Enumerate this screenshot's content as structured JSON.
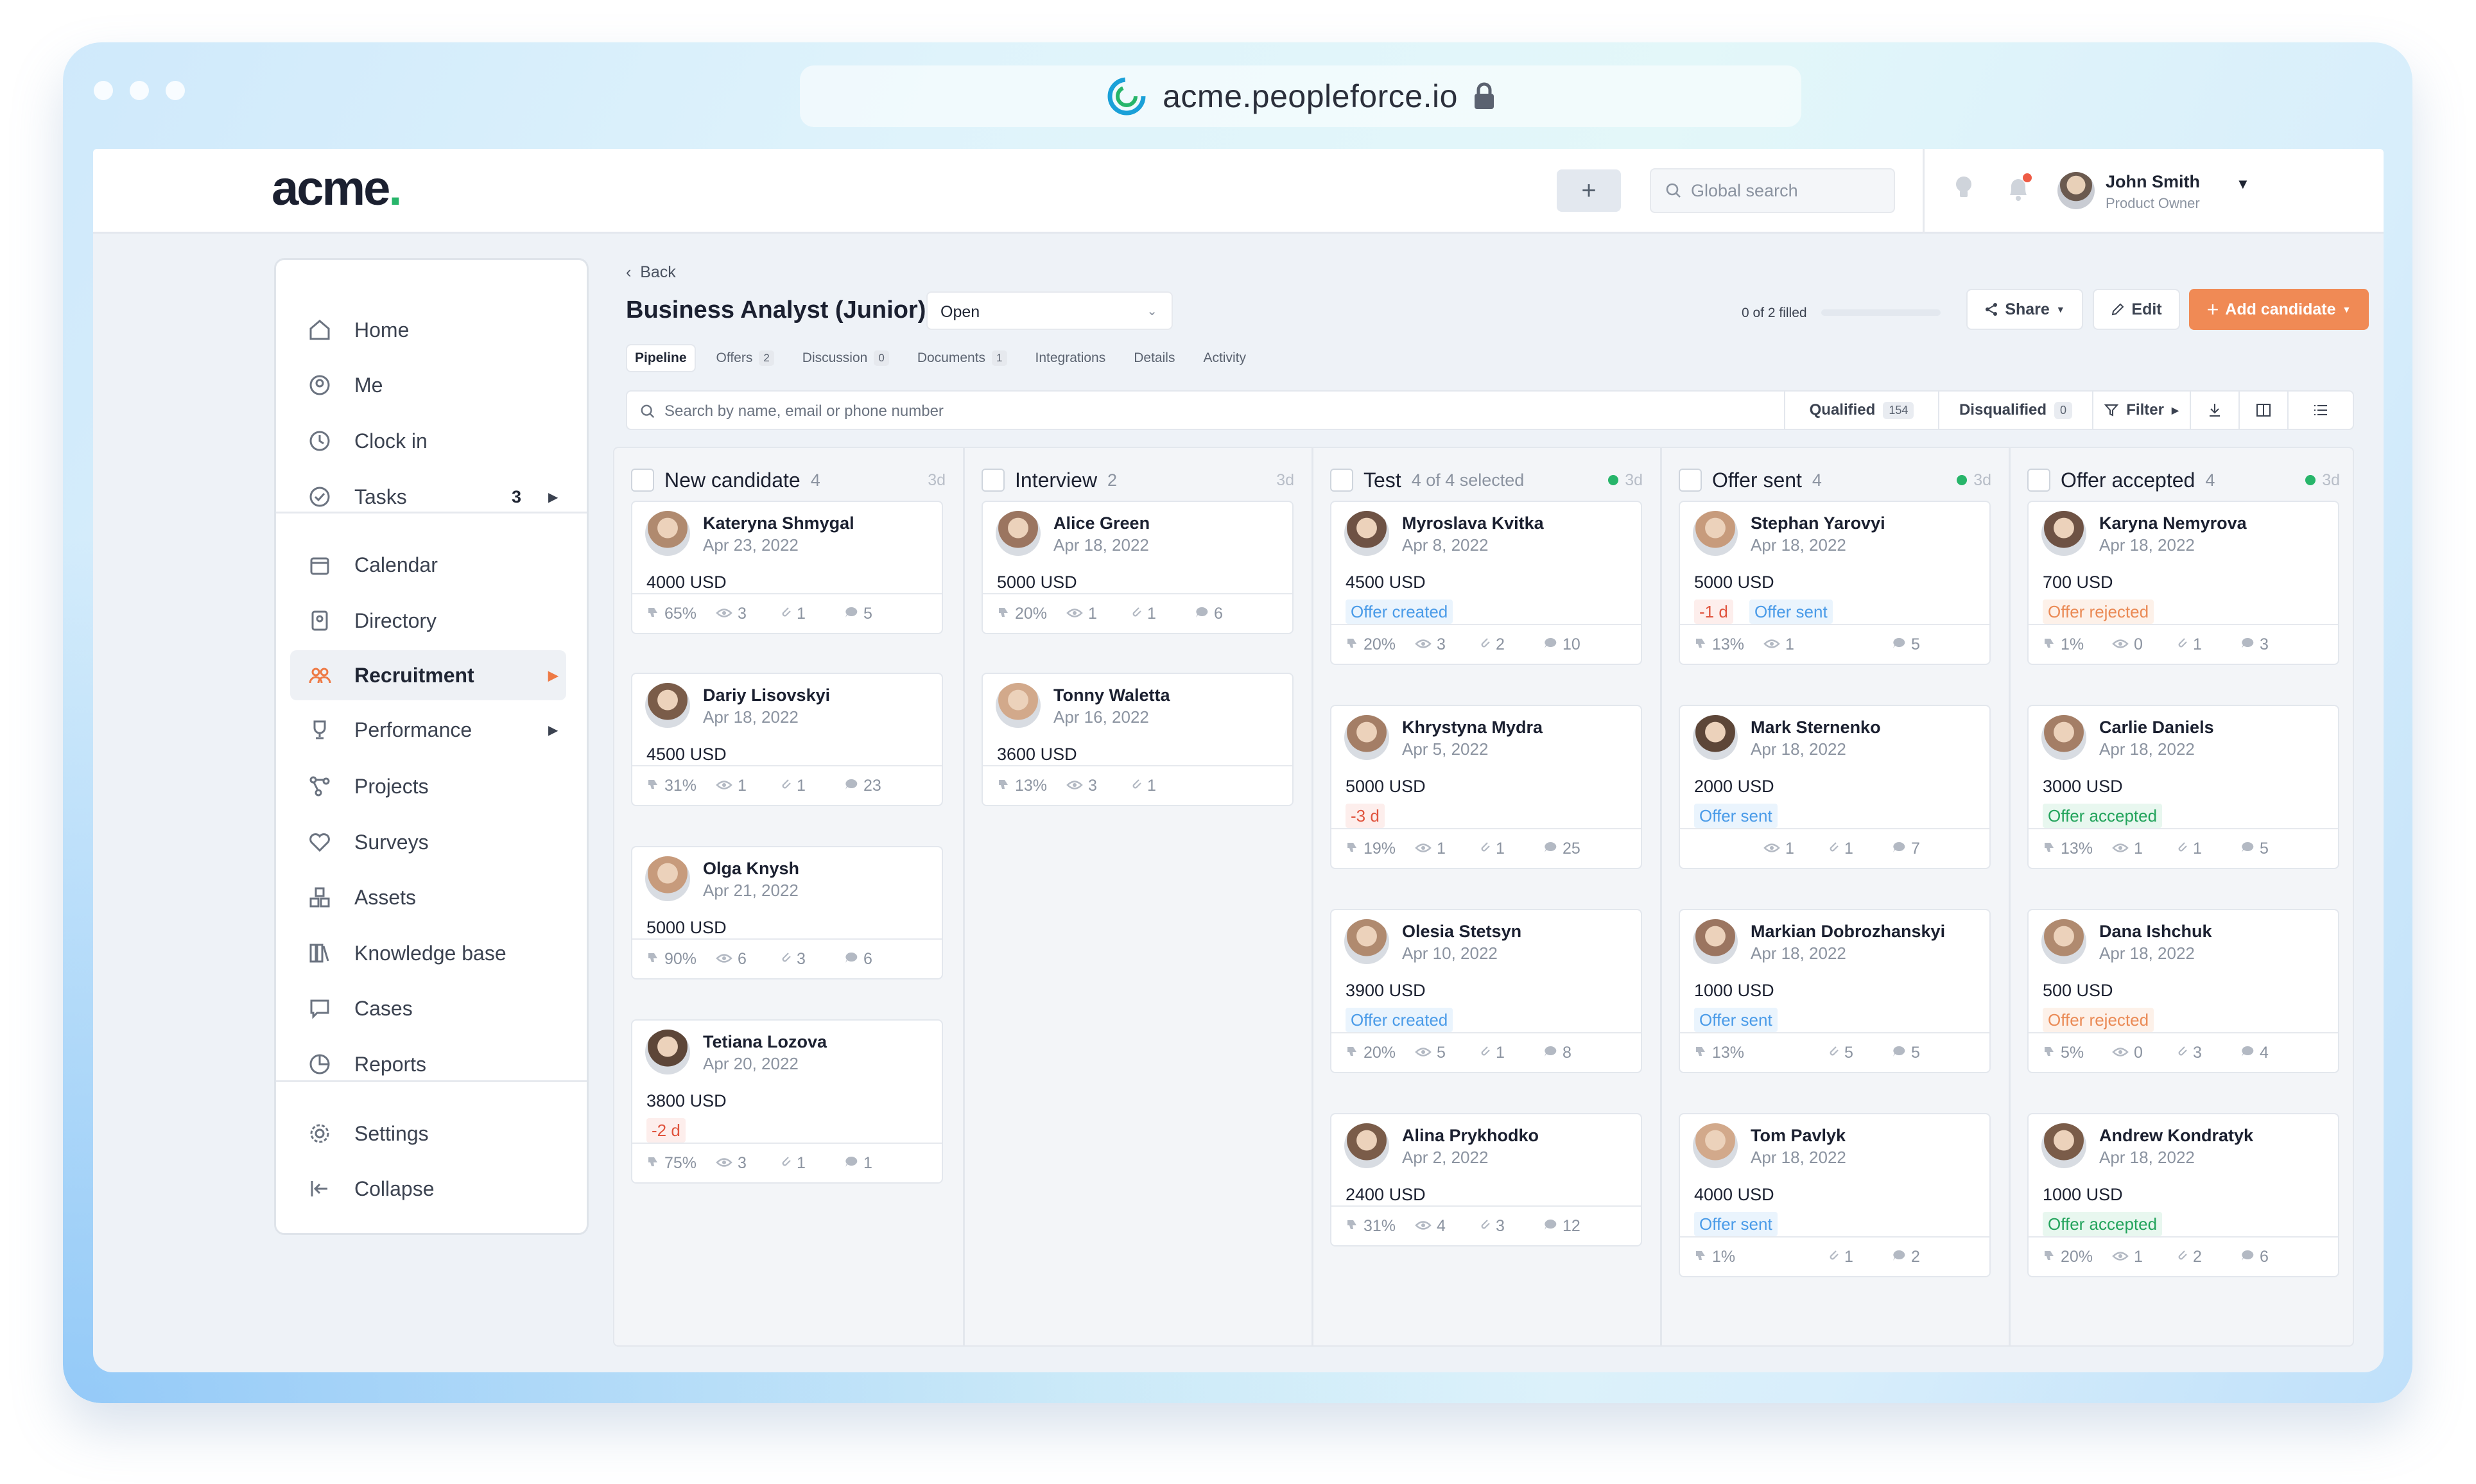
{
  "browser": {
    "url": "acme.peopleforce.io"
  },
  "header": {
    "logo": "acme",
    "logo_dot": ".",
    "add_label": "+",
    "search_placeholder": "Global search",
    "user_name": "John Smith",
    "user_role": "Product Owner"
  },
  "sidebar": {
    "items": [
      {
        "label": "Home",
        "icon": "home-icon"
      },
      {
        "label": "Me",
        "icon": "user-circle-icon"
      },
      {
        "label": "Clock in",
        "icon": "clock-icon"
      },
      {
        "label": "Tasks",
        "icon": "check-circle-icon",
        "count": "3"
      },
      {
        "label": "Calendar",
        "icon": "calendar-icon"
      },
      {
        "label": "Directory",
        "icon": "directory-icon"
      },
      {
        "label": "Recruitment",
        "icon": "people-icon",
        "active": true
      },
      {
        "label": "Performance",
        "icon": "trophy-icon"
      },
      {
        "label": "Projects",
        "icon": "projects-icon"
      },
      {
        "label": "Surveys",
        "icon": "survey-icon"
      },
      {
        "label": "Assets",
        "icon": "assets-icon"
      },
      {
        "label": "Knowledge base",
        "icon": "book-icon"
      },
      {
        "label": "Cases",
        "icon": "chat-icon"
      },
      {
        "label": "Reports",
        "icon": "pie-chart-icon"
      },
      {
        "label": "Settings",
        "icon": "gear-icon"
      },
      {
        "label": "Collapse",
        "icon": "collapse-icon"
      }
    ]
  },
  "job": {
    "back_label": "Back",
    "title": "Business Analyst (Junior)",
    "status": "Open",
    "filled_text": "0 of 2 filled",
    "share_label": "Share",
    "edit_label": "Edit",
    "add_candidate_label": "Add candidate",
    "accent_color": "#f08a55"
  },
  "tabs": [
    {
      "label": "Pipeline",
      "active": true
    },
    {
      "label": "Offers",
      "badge": "2"
    },
    {
      "label": "Discussion",
      "badge": "0"
    },
    {
      "label": "Documents",
      "badge": "1"
    },
    {
      "label": "Integrations"
    },
    {
      "label": "Details"
    },
    {
      "label": "Activity"
    }
  ],
  "searchbar": {
    "placeholder": "Search by name, email or phone number",
    "qualified_label": "Qualified",
    "qualified_count": "154",
    "disqualified_label": "Disqualified",
    "disqualified_count": "0",
    "filter_label": "Filter"
  },
  "columns": [
    {
      "title": "New candidate",
      "count": "4",
      "age": "3d",
      "status_dot": false,
      "cards": [
        {
          "name": "Kateryna Shmygal",
          "date": "Apr 23, 2022",
          "salary": "4000 USD",
          "stats": [
            "65%",
            "3",
            "1",
            "5"
          ]
        },
        {
          "name": "Dariy Lisovskyi",
          "date": "Apr 18, 2022",
          "salary": "4500 USD",
          "stats": [
            "31%",
            "1",
            "1",
            "23"
          ]
        },
        {
          "name": "Olga Knysh",
          "date": "Apr 21, 2022",
          "salary": "5000 USD",
          "stats": [
            "90%",
            "6",
            "3",
            "6"
          ]
        },
        {
          "name": "Tetiana Lozova",
          "date": "Apr 20, 2022",
          "salary": "3800 USD",
          "pills": [
            {
              "text": "-2 d",
              "tone": "red"
            }
          ],
          "stats": [
            "75%",
            "3",
            "1",
            "1"
          ]
        }
      ]
    },
    {
      "title": "Interview",
      "count": "2",
      "age": "3d",
      "status_dot": false,
      "cards": [
        {
          "name": "Alice Green",
          "date": "Apr 18, 2022",
          "salary": "5000 USD",
          "stats": [
            "20%",
            "1",
            "1",
            "6"
          ]
        },
        {
          "name": "Tonny Waletta",
          "date": "Apr 16, 2022",
          "salary": "3600 USD",
          "stats": [
            "13%",
            "3",
            "1",
            ""
          ]
        }
      ]
    },
    {
      "title": "Test",
      "count": "4 of 4 selected",
      "age": "3d",
      "status_dot": true,
      "cards": [
        {
          "name": "Myroslava Kvitka",
          "date": "Apr 8, 2022",
          "salary": "4500 USD",
          "pills": [
            {
              "text": "Offer created",
              "tone": "blue"
            }
          ],
          "stats": [
            "20%",
            "3",
            "2",
            "10"
          ]
        },
        {
          "name": "Khrystyna Mydra",
          "date": "Apr 5, 2022",
          "salary": "5000 USD",
          "pills": [
            {
              "text": "-3 d",
              "tone": "red"
            }
          ],
          "stats": [
            "19%",
            "1",
            "1",
            "25"
          ]
        },
        {
          "name": "Olesia Stetsyn",
          "date": "Apr 10, 2022",
          "salary": "3900 USD",
          "pills": [
            {
              "text": "Offer created",
              "tone": "blue"
            }
          ],
          "stats": [
            "20%",
            "5",
            "1",
            "8"
          ]
        },
        {
          "name": "Alina Prykhodko",
          "date": "Apr 2, 2022",
          "salary": "2400 USD",
          "stats": [
            "31%",
            "4",
            "3",
            "12"
          ]
        }
      ]
    },
    {
      "title": "Offer sent",
      "count": "4",
      "age": "3d",
      "status_dot": true,
      "cards": [
        {
          "name": "Stephan Yarovyi",
          "date": "Apr 18, 2022",
          "salary": "5000 USD",
          "pills": [
            {
              "text": "-1 d",
              "tone": "red"
            },
            {
              "text": "Offer sent",
              "tone": "blue"
            }
          ],
          "stats": [
            "13%",
            "1",
            "",
            "5"
          ]
        },
        {
          "name": "Mark Sternenko",
          "date": "Apr 18, 2022",
          "salary": "2000 USD",
          "pills": [
            {
              "text": "Offer sent",
              "tone": "blue"
            }
          ],
          "stats": [
            "",
            "1",
            "1",
            "7"
          ]
        },
        {
          "name": "Markian Dobrozhanskyi",
          "date": "Apr 18, 2022",
          "salary": "1000 USD",
          "pills": [
            {
              "text": "Offer sent",
              "tone": "blue"
            }
          ],
          "stats": [
            "13%",
            "",
            "5",
            "5"
          ]
        },
        {
          "name": "Tom Pavlyk",
          "date": "Apr 18, 2022",
          "salary": "4000 USD",
          "pills": [
            {
              "text": "Offer sent",
              "tone": "blue"
            }
          ],
          "stats": [
            "1%",
            "",
            "1",
            "2"
          ]
        }
      ]
    },
    {
      "title": "Offer accepted",
      "count": "4",
      "age": "3d",
      "status_dot": true,
      "cards": [
        {
          "name": "Karyna Nemyrova",
          "date": "Apr 18, 2022",
          "salary": "700 USD",
          "pills": [
            {
              "text": "Offer rejected",
              "tone": "orange"
            }
          ],
          "stats": [
            "1%",
            "0",
            "1",
            "3"
          ]
        },
        {
          "name": "Carlie Daniels",
          "date": "Apr 18, 2022",
          "salary": "3000 USD",
          "pills": [
            {
              "text": "Offer accepted",
              "tone": "green"
            }
          ],
          "stats": [
            "13%",
            "1",
            "1",
            "5"
          ]
        },
        {
          "name": "Dana Ishchuk",
          "date": "Apr 18, 2022",
          "salary": "500 USD",
          "pills": [
            {
              "text": "Offer rejected",
              "tone": "orange"
            }
          ],
          "stats": [
            "5%",
            "0",
            "3",
            "4"
          ]
        },
        {
          "name": "Andrew Kondratyk",
          "date": "Apr 18, 2022",
          "salary": "1000 USD",
          "pills": [
            {
              "text": "Offer accepted",
              "tone": "green"
            }
          ],
          "stats": [
            "20%",
            "1",
            "2",
            "6"
          ]
        }
      ]
    }
  ]
}
